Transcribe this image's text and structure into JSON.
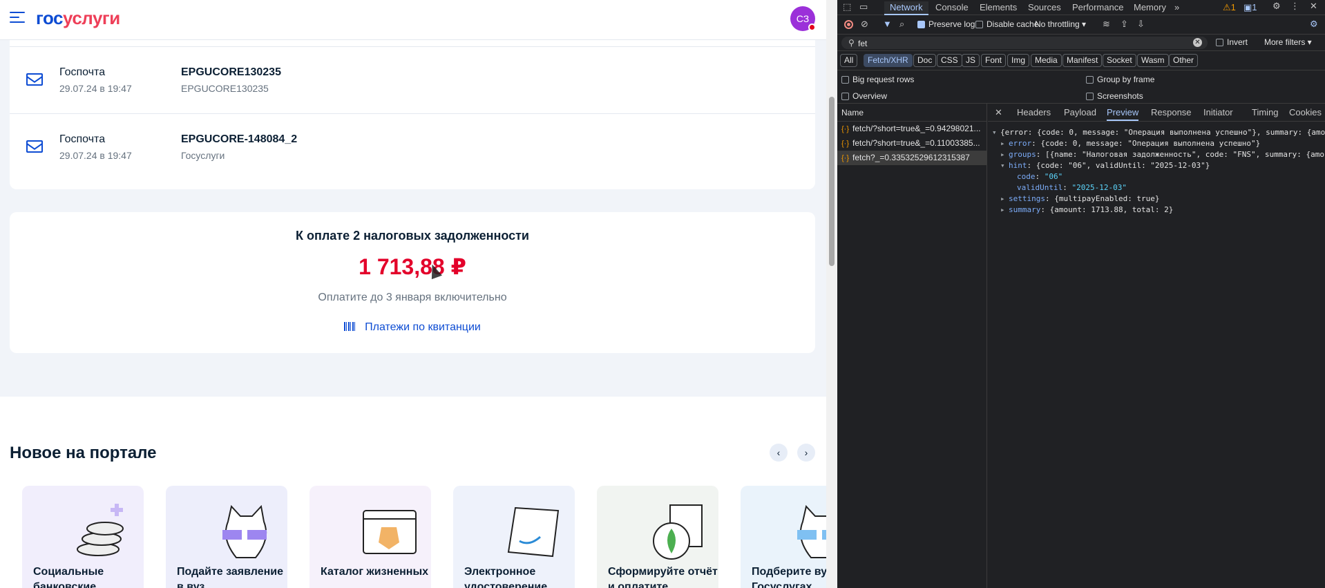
{
  "portal": {
    "logo_part1": "гос",
    "logo_part2": "услуги",
    "avatar_initials": "СЗ",
    "mail": [
      {
        "from": "Госпочта",
        "date": "29.07.24 в 19:47",
        "subject": "EPGUCORE130235",
        "sub": "EPGUCORE130235"
      },
      {
        "from": "Госпочта",
        "date": "29.07.24 в 19:47",
        "subject": "EPGUCORE-148084_2",
        "sub": "Госуслуги"
      }
    ],
    "pay": {
      "title": "К оплате 2 налоговых задолженности",
      "amount": "1 713,88 ₽",
      "note": "Оплатите до 3 января включительно",
      "link": "Платежи по квитанции"
    },
    "news_title": "Новое на портале",
    "tiles": [
      {
        "label": "Социальные банковские",
        "color": "#f1eefc"
      },
      {
        "label": "Подайте заявление в вуз",
        "color": "#edeefb"
      },
      {
        "label": "Каталог жизненных",
        "color": "#f6f1fb"
      },
      {
        "label": "Электронное удостоверение",
        "color": "#eef2fb"
      },
      {
        "label": "Сформируйте отчёт и оплатите",
        "color": "#f1f4f1"
      },
      {
        "label": "Подберите вуз на Госуслугах",
        "color": "#eaf3fb"
      }
    ]
  },
  "devtools": {
    "tabs": [
      "Network",
      "Console",
      "Elements",
      "Sources",
      "Performance",
      "Memory"
    ],
    "more_tabs": "»",
    "warn_count": "1",
    "msg_count": "1",
    "toolbar": {
      "preserve_log": "Preserve log",
      "disable_cache": "Disable cache",
      "throttling": "No throttling"
    },
    "filter": {
      "value": "fet",
      "invert": "Invert",
      "more_filters": "More filters"
    },
    "types": [
      "All",
      "Fetch/XHR",
      "Doc",
      "CSS",
      "JS",
      "Font",
      "Img",
      "Media",
      "Manifest",
      "Socket",
      "Wasm",
      "Other"
    ],
    "options": {
      "big_rows": "Big request rows",
      "group_frame": "Group by frame",
      "overview": "Overview",
      "screenshots": "Screenshots"
    },
    "name_header": "Name",
    "requests": [
      "fetch/?short=true&_=0.94298021...",
      "fetch/?short=true&_=0.11003385...",
      "fetch?_=0.33532529612315387"
    ],
    "preview_tabs": [
      "Headers",
      "Payload",
      "Preview",
      "Response",
      "Initiator",
      "Timing",
      "Cookies"
    ],
    "preview": {
      "root": "{error: {code: 0, message: \"Операция выполнена успешно\"}, summary: {amo",
      "error_key": "error",
      "error_val": ": {code: 0, message: \"Операция выполнена успешно\"}",
      "groups_key": "groups",
      "groups_val": ": [{name: \"Налоговая задолженность\", code: \"FNS\", summary: {amo",
      "hint_key": "hint",
      "hint_val": ": {code: \"06\", validUntil: \"2025-12-03\"}",
      "code_key": "code",
      "code_val": "\"06\"",
      "valid_key": "validUntil",
      "valid_val": "\"2025-12-03\"",
      "settings_key": "settings",
      "settings_val": ": {multipayEnabled: true}",
      "summary_key": "summary",
      "summary_val": ": {amount: 1713.88, total: 2}"
    }
  }
}
